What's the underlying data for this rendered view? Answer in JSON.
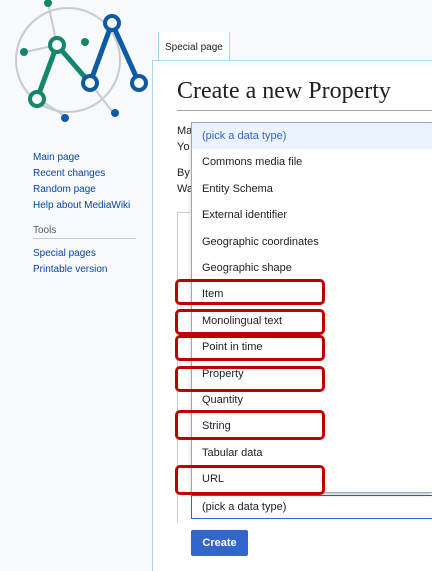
{
  "sidebar": {
    "nav": [
      "Main page",
      "Recent changes",
      "Random page",
      "Help about MediaWiki"
    ],
    "tools_heading": "Tools",
    "tools": [
      "Special pages",
      "Printable version"
    ]
  },
  "tabs": {
    "special_page": "Special page"
  },
  "main": {
    "title": "Create a new Property",
    "clipped_text": [
      "Ma",
      "Yo",
      "By",
      "Wa"
    ],
    "datatype_select_value": "(pick a data type)",
    "create_label": "Create"
  },
  "dropdown": {
    "options": [
      "(pick a data type)",
      "Commons media file",
      "Entity Schema",
      "External identifier",
      "Geographic coordinates",
      "Geographic shape",
      "Item",
      "Monolingual text",
      "Point in time",
      "Property",
      "Quantity",
      "String",
      "Tabular data",
      "URL"
    ],
    "highlighted": "(pick a data type)",
    "marked": [
      "Item",
      "Monolingual text",
      "Point in time",
      "Property",
      "String",
      "URL"
    ]
  },
  "colors": {
    "accent": "#3366cc",
    "mark": "#c00000",
    "logo_teal": "#14866d",
    "logo_blue": "#0f5aa5"
  }
}
